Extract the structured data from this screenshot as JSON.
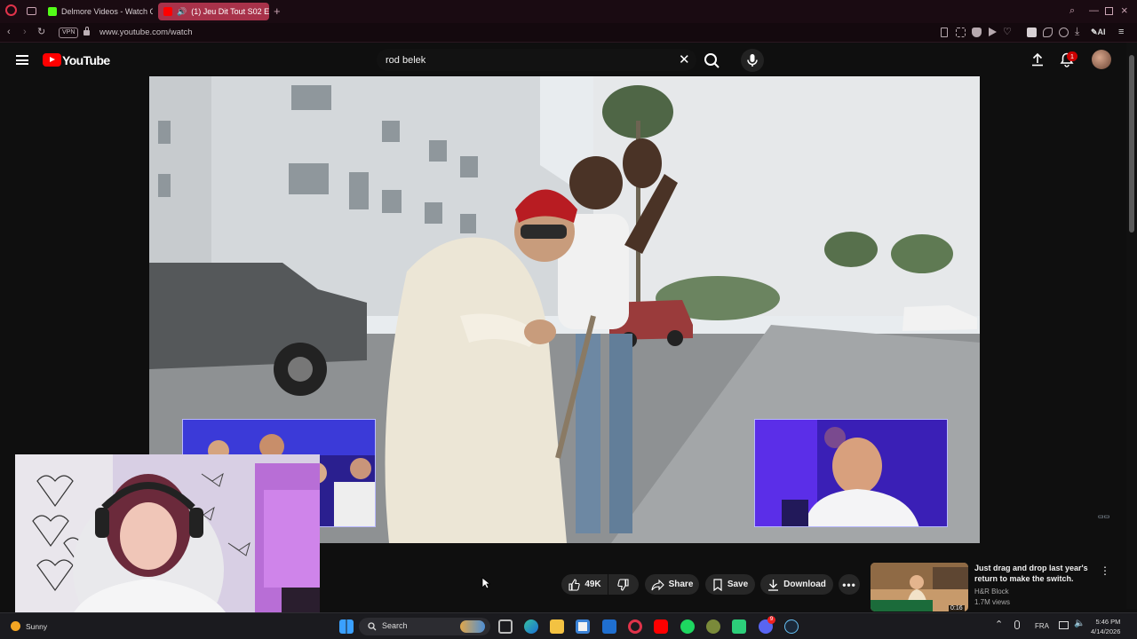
{
  "browser": {
    "tabs": [
      {
        "label": "Delmore Videos - Watch C",
        "active": false
      },
      {
        "label": "(1) Jeu Dit Tout S02 Ep",
        "active": true
      }
    ],
    "new_tab_icon": "plus-icon",
    "vpn_label": "VPN",
    "url": "www.youtube.com/watch",
    "ai_label": "AI"
  },
  "youtube": {
    "logo_text": "YouTube",
    "search": {
      "value": "rod belek"
    },
    "notification_count": "1"
  },
  "actions": {
    "likes": "49K",
    "share": "Share",
    "save": "Save",
    "download": "Download"
  },
  "recommended": {
    "title": "Just drag and drop last year's return to make the switch.",
    "channel": "H&R Block",
    "views": "1.7M views",
    "duration": "0:16"
  },
  "taskbar": {
    "weather": "Sunny",
    "search_label": "Search",
    "language": "FRA",
    "time": "5:46 PM",
    "date": "4/14/2026",
    "discord_badge": "9"
  },
  "colors": {
    "tab_active": "#a8324a",
    "youtube_red": "#ff0000",
    "badge_red": "#cc0000"
  }
}
